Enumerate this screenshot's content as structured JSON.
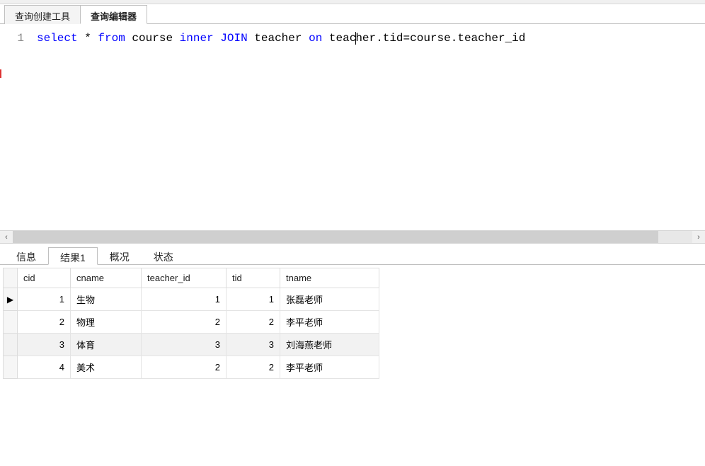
{
  "top_tabs": {
    "query_builder": "查询创建工具",
    "query_editor": "查询编辑器"
  },
  "editor": {
    "line_number": "1",
    "sql_tokens": {
      "select": "select",
      "star": " * ",
      "from": "from",
      "course1": " course ",
      "inner": "inner",
      "sp1": " ",
      "join": "JOIN",
      "teacher1": " teacher ",
      "on": "on",
      "rest_a": " teac",
      "rest_b": "her.tid=course.teacher_id"
    }
  },
  "result_tabs": {
    "info": "信息",
    "result1": "结果1",
    "profile": "概况",
    "status": "状态"
  },
  "grid": {
    "headers": {
      "cid": "cid",
      "cname": "cname",
      "teacher_id": "teacher_id",
      "tid": "tid",
      "tname": "tname"
    },
    "rows": [
      {
        "marker": "▶",
        "cid": "1",
        "cname": "生物",
        "teacher_id": "1",
        "tid": "1",
        "tname": "张磊老师"
      },
      {
        "marker": "",
        "cid": "2",
        "cname": "物理",
        "teacher_id": "2",
        "tid": "2",
        "tname": "李平老师"
      },
      {
        "marker": "",
        "cid": "3",
        "cname": "体育",
        "teacher_id": "3",
        "tid": "3",
        "tname": "刘海燕老师"
      },
      {
        "marker": "",
        "cid": "4",
        "cname": "美术",
        "teacher_id": "2",
        "tid": "2",
        "tname": "李平老师"
      }
    ]
  }
}
